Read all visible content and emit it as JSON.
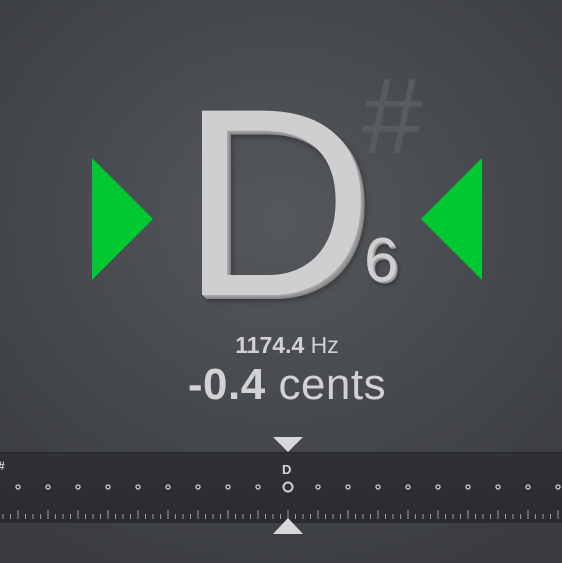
{
  "tuner": {
    "note": "D",
    "accidental": "#",
    "octave": "6",
    "frequency_value": "1174.4",
    "frequency_unit": "Hz",
    "cents_value": "-0.4",
    "cents_unit": "cents",
    "in_tune_color": "#00c830",
    "scale_center_label": "D",
    "scale_left_label": "#"
  }
}
